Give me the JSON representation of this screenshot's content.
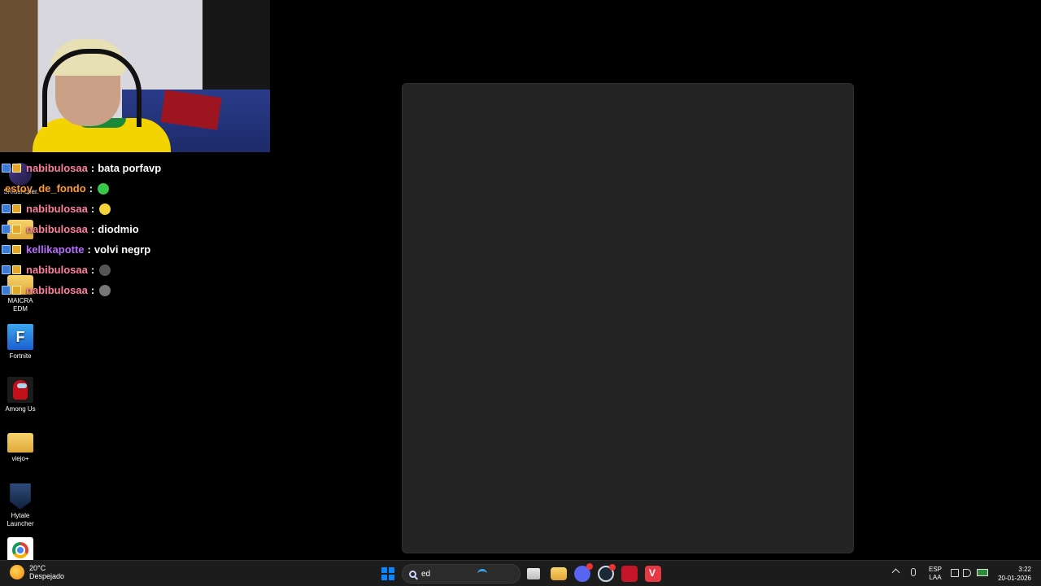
{
  "desktop_icons": [
    {
      "label": "SKlauncher",
      "icon": "sklauncher-icon"
    },
    {
      "label": "",
      "icon": "folder-icon"
    },
    {
      "label": "MAICRA EDM",
      "icon": "folder-icon"
    },
    {
      "label": "Fortnite",
      "icon": "fortnite-icon",
      "glyph": "F"
    },
    {
      "label": "Among Us",
      "icon": "among-us-icon"
    },
    {
      "label": "viejo+",
      "icon": "folder-icon"
    },
    {
      "label": "Hytale Launcher",
      "icon": "hytale-icon"
    },
    {
      "label": "",
      "icon": "chrome-icon"
    }
  ],
  "chat": {
    "messages": [
      {
        "user": "nabibulosaa",
        "color": "#ff7f9e",
        "text": "bata porfavp",
        "badges": true
      },
      {
        "user": "estoy_de_fondo",
        "color": "#ff9a2e",
        "text": "",
        "emote_color": "#38c74a",
        "badges": false
      },
      {
        "user": "nabibulosaa",
        "color": "#ff7f9e",
        "text": "",
        "emote_color": "#f5d23a",
        "badges": true
      },
      {
        "user": "nabibulosaa",
        "color": "#ff7f9e",
        "text": "diodmio",
        "badges": true
      },
      {
        "user": "kellikapotte",
        "color": "#b86bff",
        "text": "volvi negrp",
        "badges": true
      },
      {
        "user": "nabibulosaa",
        "color": "#ff7f9e",
        "text": "",
        "emote_color": "#555555",
        "badges": true
      },
      {
        "user": "nabibulosaa",
        "color": "#ff7f9e",
        "text": "",
        "emote_color": "#777777",
        "badges": true
      }
    ],
    "separator": ":"
  },
  "taskbar": {
    "weather": {
      "temp": "20°C",
      "condition": "Despejado"
    },
    "search": {
      "value": "ed"
    },
    "apps": [
      "task-view-icon",
      "file-explorer-icon",
      "discord-icon",
      "steam-icon",
      "app-icon",
      "vivaldi-icon"
    ],
    "language": {
      "line1": "ESP",
      "line2": "LAA"
    },
    "clock": {
      "time": "3:22",
      "date": "20-01-2026"
    }
  },
  "colors": {
    "window_bg": "#242424",
    "taskbar_bg": "#1c1c1c",
    "accent": "#0a84ff"
  }
}
